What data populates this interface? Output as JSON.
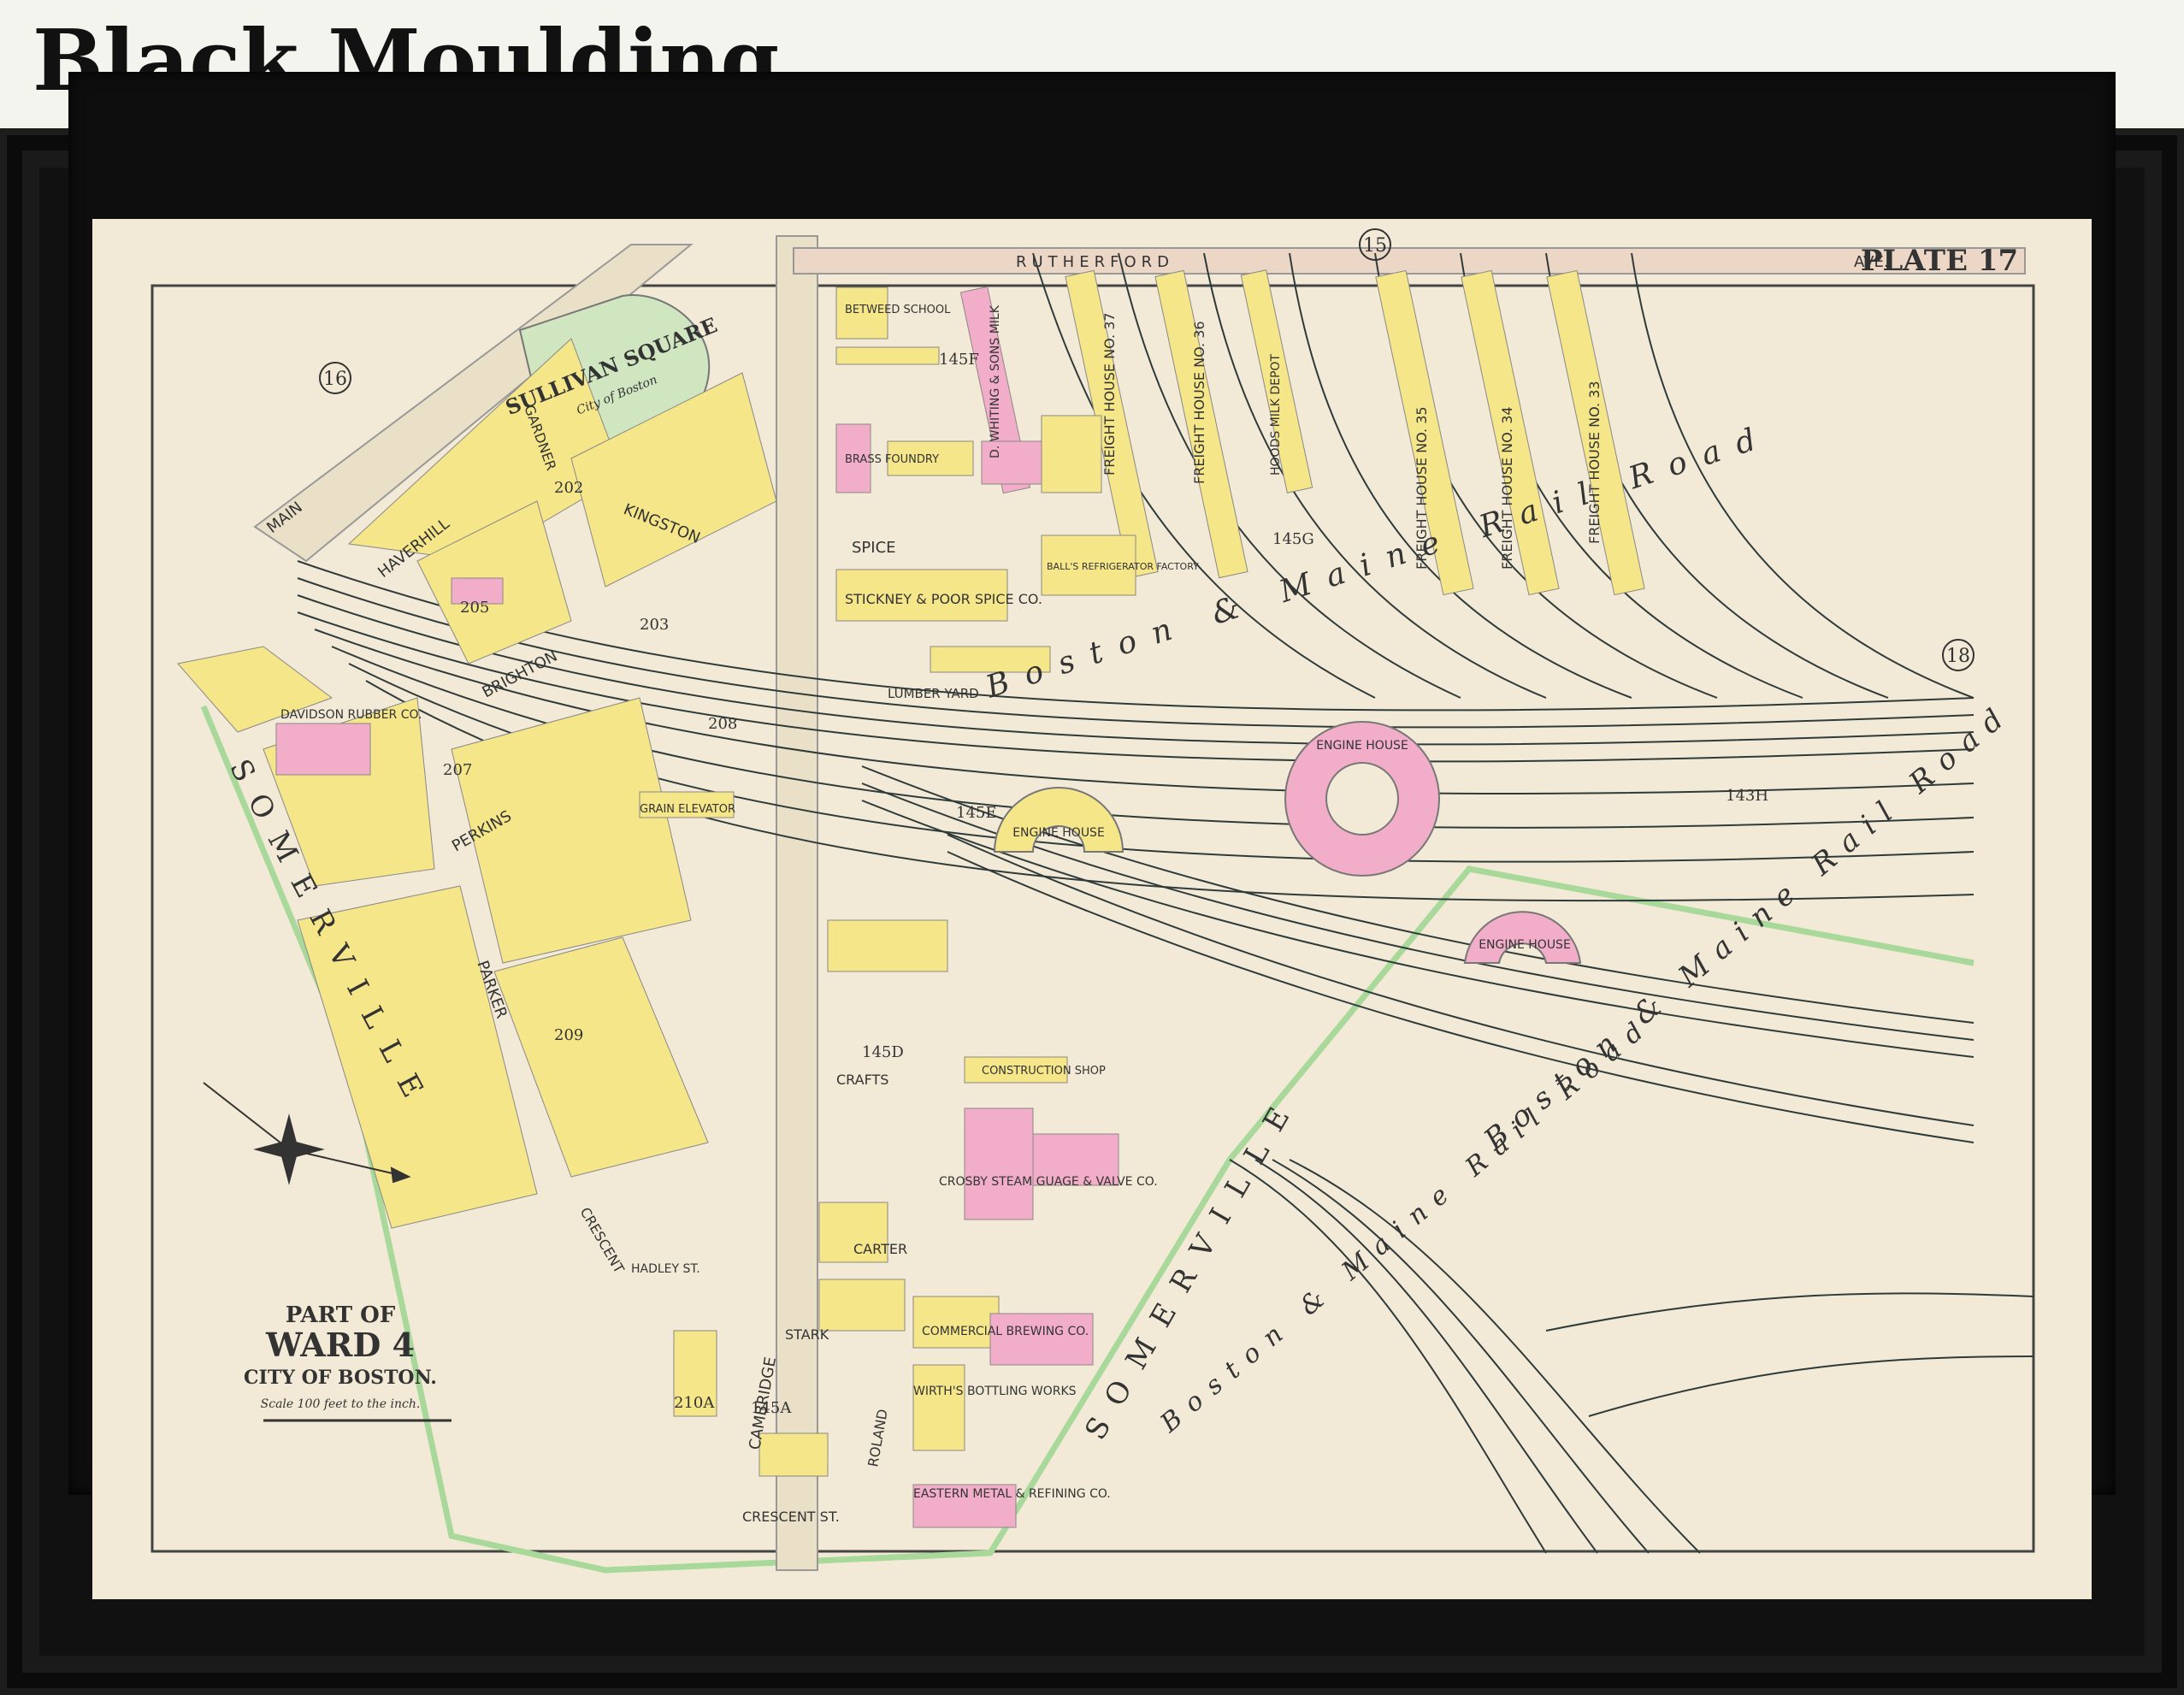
{
  "header": {
    "title": "Black Moulding"
  },
  "map": {
    "plate_label": "PLATE 17",
    "title_block": {
      "line1": "PART OF",
      "line2": "WARD 4",
      "line3": "CITY OF BOSTON.",
      "scale_text": "Scale 100 feet to the inch."
    },
    "ward_markers": [
      "16",
      "15",
      "18"
    ],
    "streets": {
      "rutherford": "RUTHERFORD",
      "ave": "AVE.",
      "main": "MAIN",
      "haverhill": "HAVERHILL",
      "kingston": "KINGSTON",
      "spice": "SPICE",
      "gardner": "GARDNER",
      "perkins": "PERKINS",
      "parker": "PARKER",
      "brighton": "BRIGHTON",
      "crafts": "CRAFTS",
      "carter": "CARTER",
      "stark": "STARK",
      "cambridge": "CAMBRIDGE",
      "roland": "ROLAND",
      "crescent": "CRESCENT",
      "crescent_st": "CRESCENT ST.",
      "hadley": "HADLEY ST.",
      "somerville": "SOMERVILLE",
      "somerville2": "SOMERVILLE",
      "railroad": "Boston & Maine Rail Road",
      "railroad2": "Boston & Maine Rail Road",
      "railroad3": "Boston & Maine Rail Road"
    },
    "parks": {
      "sullivan": "SULLIVAN SQUARE",
      "sullivan_sub": "City of Boston"
    },
    "buildings": {
      "freight_37": "FREIGHT HOUSE NO. 37",
      "freight_36": "FREIGHT HOUSE NO. 36",
      "hoods": "HOODS MILK DEPOT",
      "freight_35": "FREIGHT HOUSE NO. 35",
      "freight_34": "FREIGHT HOUSE NO. 34",
      "freight_33": "FREIGHT HOUSE NO. 33",
      "whiting": "D. WHITING & SONS MILK",
      "engine_house": "ENGINE HOUSE",
      "stickney": "STICKNEY & POOR SPICE CO.",
      "lumber_yard": "LUMBER YARD",
      "brass_foundry": "BRASS FOUNDRY",
      "davidson": "DAVIDSON RUBBER CO.",
      "grain_elevator": "GRAIN ELEVATOR",
      "construction_shop": "CONSTRUCTION SHOP",
      "crosby": "CROSBY STEAM GUAGE & VALVE CO.",
      "commercial": "COMMERCIAL BREWING CO.",
      "wirths": "WIRTH'S BOTTLING WORKS",
      "eastern": "EASTERN METAL & REFINING CO.",
      "betweed": "BETWEED SCHOOL",
      "refrig": "BALL'S REFRIGERATOR FACTORY"
    },
    "lot_numbers": [
      "145F",
      "145G",
      "145E",
      "145D",
      "145A",
      "143H",
      "202",
      "203",
      "205",
      "207",
      "208",
      "209",
      "210A"
    ],
    "colors": {
      "paper": "#f2ead6",
      "brick": "#f2aec8",
      "wood": "#f6e68a",
      "park": "#cfe6c1",
      "track": "#2f3b3b",
      "boundary": "#a8d89a"
    }
  }
}
